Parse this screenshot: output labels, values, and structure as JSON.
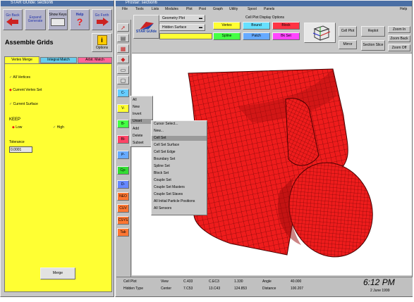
{
  "left_window": {
    "title": "STAR GUIde: section6",
    "toolbar": [
      "Go Back",
      "Expand Generate",
      "Show Keys",
      "Help",
      "Go Forth"
    ],
    "options_label": "Options",
    "panel_title": "Assemble Grids",
    "tabs": [
      "Vertex Merge",
      "Integral Match",
      "Arbit. Match"
    ],
    "options": [
      "All Vertices",
      "Current Vertex Set",
      "Current Surface"
    ],
    "keep_label": "KEEP",
    "keep_options": [
      "Low",
      "High"
    ],
    "tolerance_label": "Tolerance",
    "tolerance_value": "0.0001",
    "merge_label": "Merge"
  },
  "main_window": {
    "title": "Prostar: section6",
    "menu": [
      "File",
      "Tools",
      "Lists",
      "Modules",
      "Plot",
      "Post",
      "Graph",
      "Utility",
      "Spool",
      "Panels",
      "Help"
    ],
    "logo": "STAR GUIde",
    "plot_type": "Geometry Plot",
    "surface_mode": "Hidden Surface",
    "display_options_title": "Cell Plot Display Options",
    "display_buttons": [
      "Vertex",
      "Bound",
      "Block",
      "Spline",
      "Patch",
      "Bk Set"
    ],
    "right_buttons": [
      "Cell Plot",
      "Replot",
      "Zoom In",
      "Mirror",
      "Section Slice",
      "Zoom Back",
      "Zoom Off"
    ],
    "strip_buttons": [
      "C-",
      "V-",
      "B-",
      "Bl-",
      "P-",
      "Cp-",
      "D-",
      "NEO",
      "CUV",
      "CSYS",
      "Tab"
    ]
  },
  "context_menu": {
    "items": [
      "All",
      "New",
      "Invert",
      "Unset",
      "Add",
      "Delete",
      "Subset"
    ],
    "highlighted": "Unset"
  },
  "submenu": {
    "items": [
      "Cursor Select...",
      "New...",
      "Cell Set",
      "Cell Set Surface",
      "Cell Set Edge",
      "Boundary Set",
      "Spline Set",
      "Block Set",
      "Couple Set",
      "Couple Set Masters",
      "Couple Set Slaves",
      "All Initial Particle Positions",
      "All Sensors"
    ],
    "highlighted": "Cell Set"
  },
  "status_bar": {
    "mode_label": "Cell Plot",
    "hidden_label": "Hidden Type",
    "view_label": "View",
    "center_label": "Center",
    "view_values": [
      "C.433",
      "C.EC3",
      "1.330"
    ],
    "center_values": [
      "7.C53",
      "13.C43",
      "124.853"
    ],
    "angle_label": "Angle",
    "distance_label": "Distance",
    "angle_value": "40.000",
    "distance_value": "100.207",
    "time": "6:12 PM",
    "date": "2 June 1999"
  },
  "colors": {
    "title_bar": "#4a6fa5",
    "panel_yellow": "#ffff33",
    "mesh_red": "#ee1c1c",
    "vertex_yellow": "#ffff33",
    "bound_cyan": "#66e0ff",
    "block_red": "#ff3344",
    "spline_green": "#44ff44",
    "patch_blue": "#66aaff",
    "bkset_magenta": "#ff44ff"
  }
}
